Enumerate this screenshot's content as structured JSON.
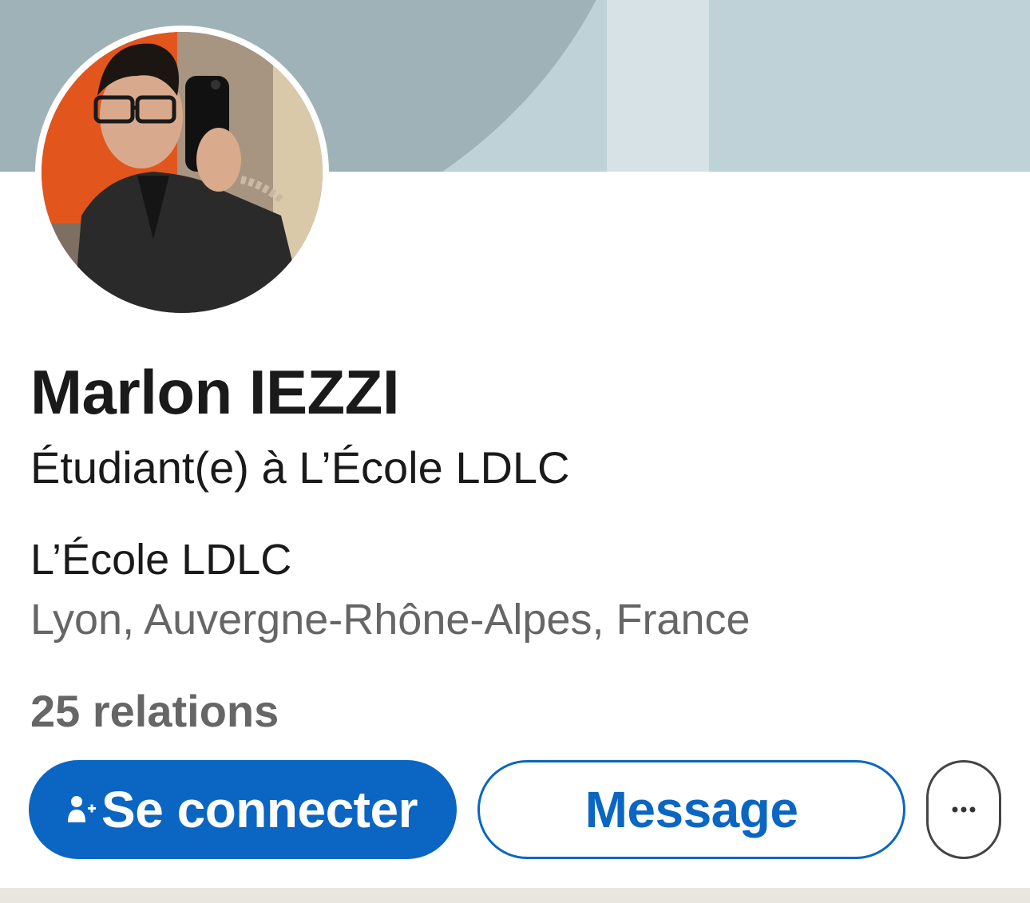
{
  "profile": {
    "name": "Marlon IEZZI",
    "headline": "Étudiant(e) à L’École LDLC",
    "company": "L’École LDLC",
    "location": "Lyon, Auvergne-Rhône-Alpes, France",
    "connections": "25 relations"
  },
  "actions": {
    "connect_label": "Se connecter",
    "connect_icon": "add-person-icon",
    "message_label": "Message",
    "more_icon": "more-horizontal-icon"
  },
  "colors": {
    "primary": "#0a66c2",
    "banner_light": "#bfd2d7",
    "banner_dark": "#9fb2b7",
    "text": "#1a1a1a",
    "muted": "#666666"
  }
}
